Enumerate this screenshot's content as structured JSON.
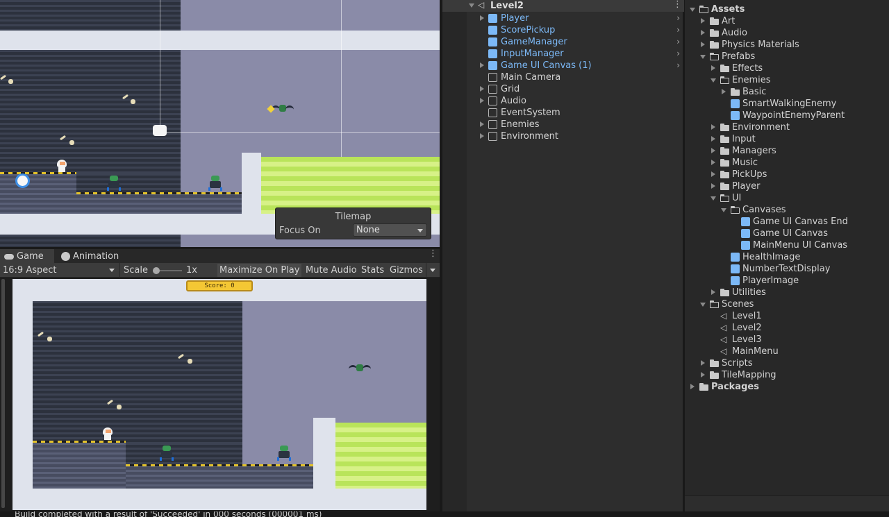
{
  "scene": {
    "tilemap_overlay": {
      "title": "Tilemap",
      "focus_label": "Focus On",
      "focus_value": "None"
    }
  },
  "game_view": {
    "tabs": [
      {
        "label": "Game",
        "icon": "gamepad-icon"
      },
      {
        "label": "Animation",
        "icon": "clock-icon"
      }
    ],
    "toolbar": {
      "aspect": "16:9 Aspect",
      "scale_label": "Scale",
      "scale_value": "1x",
      "maximize": "Maximize On Play",
      "mute": "Mute Audio",
      "stats": "Stats",
      "gizmos": "Gizmos"
    },
    "score_text": "Score: 0"
  },
  "hierarchy": {
    "root": "Level2",
    "items": [
      {
        "label": "Player",
        "prefab": true
      },
      {
        "label": "ScorePickup",
        "prefab": true
      },
      {
        "label": "GameManager",
        "prefab": true
      },
      {
        "label": "InputManager",
        "prefab": true
      },
      {
        "label": "Game UI Canvas (1)",
        "prefab": true
      },
      {
        "label": "Main Camera",
        "prefab": false
      },
      {
        "label": "Grid",
        "prefab": false
      },
      {
        "label": "Audio",
        "prefab": false
      },
      {
        "label": "EventSystem",
        "prefab": false
      },
      {
        "label": "Enemies",
        "prefab": false
      },
      {
        "label": "Environment",
        "prefab": false
      }
    ]
  },
  "project": {
    "tree": [
      {
        "label": "Assets",
        "kind": "folder-open"
      },
      {
        "label": "Art",
        "kind": "folder"
      },
      {
        "label": "Audio",
        "kind": "folder"
      },
      {
        "label": "Physics Materials",
        "kind": "folder"
      },
      {
        "label": "Prefabs",
        "kind": "folder-open"
      },
      {
        "label": "Effects",
        "kind": "folder"
      },
      {
        "label": "Enemies",
        "kind": "folder-open"
      },
      {
        "label": "Basic",
        "kind": "folder"
      },
      {
        "label": "SmartWalkingEnemy",
        "kind": "prefab"
      },
      {
        "label": "WaypointEnemyParent",
        "kind": "prefab"
      },
      {
        "label": "Environment",
        "kind": "folder"
      },
      {
        "label": "Input",
        "kind": "folder"
      },
      {
        "label": "Managers",
        "kind": "folder"
      },
      {
        "label": "Music",
        "kind": "folder"
      },
      {
        "label": "PickUps",
        "kind": "folder"
      },
      {
        "label": "Player",
        "kind": "folder"
      },
      {
        "label": "UI",
        "kind": "folder-open"
      },
      {
        "label": "Canvases",
        "kind": "folder-open"
      },
      {
        "label": "Game UI Canvas End",
        "kind": "prefab"
      },
      {
        "label": "Game UI Canvas",
        "kind": "prefab"
      },
      {
        "label": "MainMenu UI Canvas",
        "kind": "prefab"
      },
      {
        "label": "HealthImage",
        "kind": "prefab"
      },
      {
        "label": "NumberTextDisplay",
        "kind": "prefab"
      },
      {
        "label": "PlayerImage",
        "kind": "prefab"
      },
      {
        "label": "Utilities",
        "kind": "folder"
      },
      {
        "label": "Scenes",
        "kind": "folder-open"
      },
      {
        "label": "Level1",
        "kind": "scene"
      },
      {
        "label": "Level2",
        "kind": "scene"
      },
      {
        "label": "Level3",
        "kind": "scene"
      },
      {
        "label": "MainMenu",
        "kind": "scene"
      },
      {
        "label": "Scripts",
        "kind": "folder"
      },
      {
        "label": "TileMapping",
        "kind": "folder"
      },
      {
        "label": "Packages",
        "kind": "folder"
      }
    ]
  },
  "status_bar": {
    "text": "Build completed with a result of 'Succeeded' in 000 seconds (000001 ms)"
  },
  "colors": {
    "prefab_blue": "#7cb9f7",
    "panel_bg": "#2d2d2d",
    "accent_yellow": "#f4c734"
  }
}
